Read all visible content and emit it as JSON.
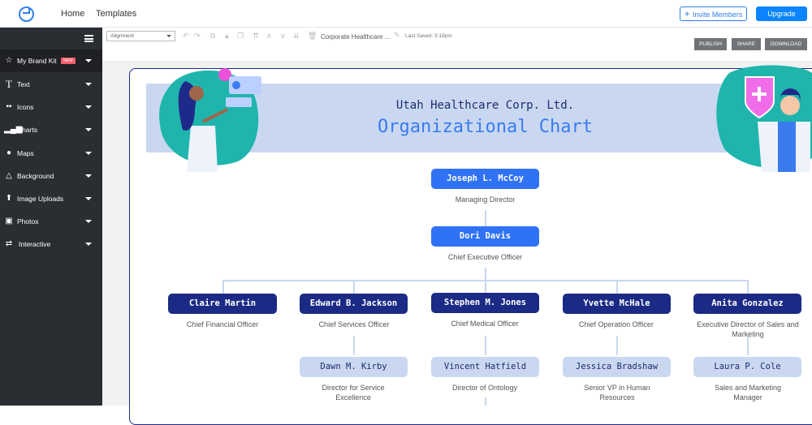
{
  "topbar": {
    "nav": [
      "Home",
      "Templates"
    ],
    "invite_label": "Invite Members",
    "upgrade_label": "Upgrade"
  },
  "sidebar": {
    "items": [
      {
        "label": "My Brand Kit",
        "icon": "star-icon",
        "badge": "NEW"
      },
      {
        "label": "Text",
        "icon": "text-icon"
      },
      {
        "label": "Icons",
        "icon": "icons-grid-icon"
      },
      {
        "label": "Charts",
        "icon": "bar-chart-icon"
      },
      {
        "label": "Maps",
        "icon": "globe-icon"
      },
      {
        "label": "Background",
        "icon": "paint-drop-icon"
      },
      {
        "label": "Image Uploads",
        "icon": "upload-icon"
      },
      {
        "label": "Photos",
        "icon": "photo-icon"
      },
      {
        "label": "Interactive",
        "icon": "shuffle-icon"
      }
    ]
  },
  "toolbar": {
    "alignment_value": "Alignment",
    "doc_name": "Corporate Healthcare ...",
    "last_saved": "Last Saved: 5:18pm",
    "publish": "PUBLISH",
    "share": "SHARE",
    "download": "DOWNLOAD"
  },
  "chart": {
    "subtitle": "Utah Healthcare Corp. Ltd.",
    "title": "Organizational Chart",
    "top": [
      {
        "name": "Joseph L. McCoy",
        "role": "Managing Director"
      },
      {
        "name": "Dori Davis",
        "role": "Chief Executive Officer"
      }
    ],
    "level2": [
      {
        "name": "Claire Martin",
        "role": "Chief Financial Officer"
      },
      {
        "name": "Edward B. Jackson",
        "role": "Chief Services Officer"
      },
      {
        "name": "Stephen M. Jones",
        "role": "Chief Medical Officer"
      },
      {
        "name": "Yvette McHale",
        "role": "Chief Operation Officer"
      },
      {
        "name": "Anita Gonzalez",
        "role": "Executive Director of Sales and Marketing"
      }
    ],
    "level3": [
      {
        "name": "Dawn M. Kirby",
        "role": "Director for Service Excellence"
      },
      {
        "name": "Vincent Hatfield",
        "role": "Director of Ontology"
      },
      {
        "name": "Jessica Bradshaw",
        "role": "Senior VP in Human Resources"
      },
      {
        "name": "Laura P. Cole",
        "role": "Sales and Marketing Manager"
      }
    ]
  }
}
